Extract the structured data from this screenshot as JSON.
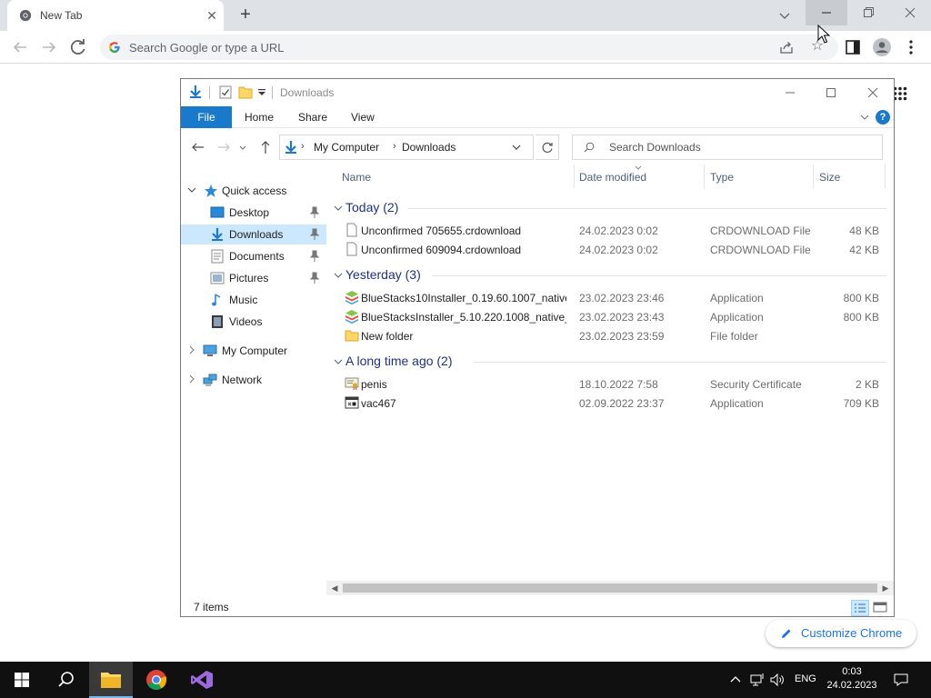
{
  "chrome": {
    "tab_title": "New Tab",
    "omnibox_placeholder": "Search Google or type a URL",
    "customize_label": "Customize Chrome"
  },
  "explorer": {
    "title": "Downloads",
    "ribbon_tabs": [
      "File",
      "Home",
      "Share",
      "View"
    ],
    "breadcrumb": [
      "My Computer",
      "Downloads"
    ],
    "search_placeholder": "Search Downloads",
    "nav": {
      "quick_access": "Quick access",
      "items": [
        "Desktop",
        "Downloads",
        "Documents",
        "Pictures",
        "Music",
        "Videos"
      ],
      "my_computer": "My Computer",
      "network": "Network"
    },
    "columns": [
      "Name",
      "Date modified",
      "Type",
      "Size"
    ],
    "groups": [
      {
        "label": "Today (2)",
        "files": [
          {
            "name": "Unconfirmed 705655.crdownload",
            "date": "24.02.2023 0:02",
            "type": "CRDOWNLOAD File",
            "size": "48 KB",
            "icon": "file-icon"
          },
          {
            "name": "Unconfirmed 609094.crdownload",
            "date": "24.02.2023 0:02",
            "type": "CRDOWNLOAD File",
            "size": "42 KB",
            "icon": "file-icon"
          }
        ]
      },
      {
        "label": "Yesterday (3)",
        "files": [
          {
            "name": "BlueStacks10Installer_0.19.60.1007_native...",
            "date": "23.02.2023 23:46",
            "type": "Application",
            "size": "800 KB",
            "icon": "bluestacks-icon"
          },
          {
            "name": "BlueStacksInstaller_5.10.220.1008_native_...",
            "date": "23.02.2023 23:43",
            "type": "Application",
            "size": "800 KB",
            "icon": "bluestacks-icon"
          },
          {
            "name": "New folder",
            "date": "23.02.2023 23:59",
            "type": "File folder",
            "size": "",
            "icon": "folder-icon"
          }
        ]
      },
      {
        "label": "A long time ago (2)",
        "files": [
          {
            "name": "penis",
            "date": "18.10.2022 7:58",
            "type": "Security Certificate",
            "size": "2 KB",
            "icon": "certificate-icon"
          },
          {
            "name": "vac467",
            "date": "02.09.2022 23:37",
            "type": "Application",
            "size": "709 KB",
            "icon": "application-icon"
          }
        ]
      }
    ],
    "status": "7 items"
  },
  "taskbar": {
    "lang": "ENG",
    "time": "0:03",
    "date": "24.02.2023"
  }
}
